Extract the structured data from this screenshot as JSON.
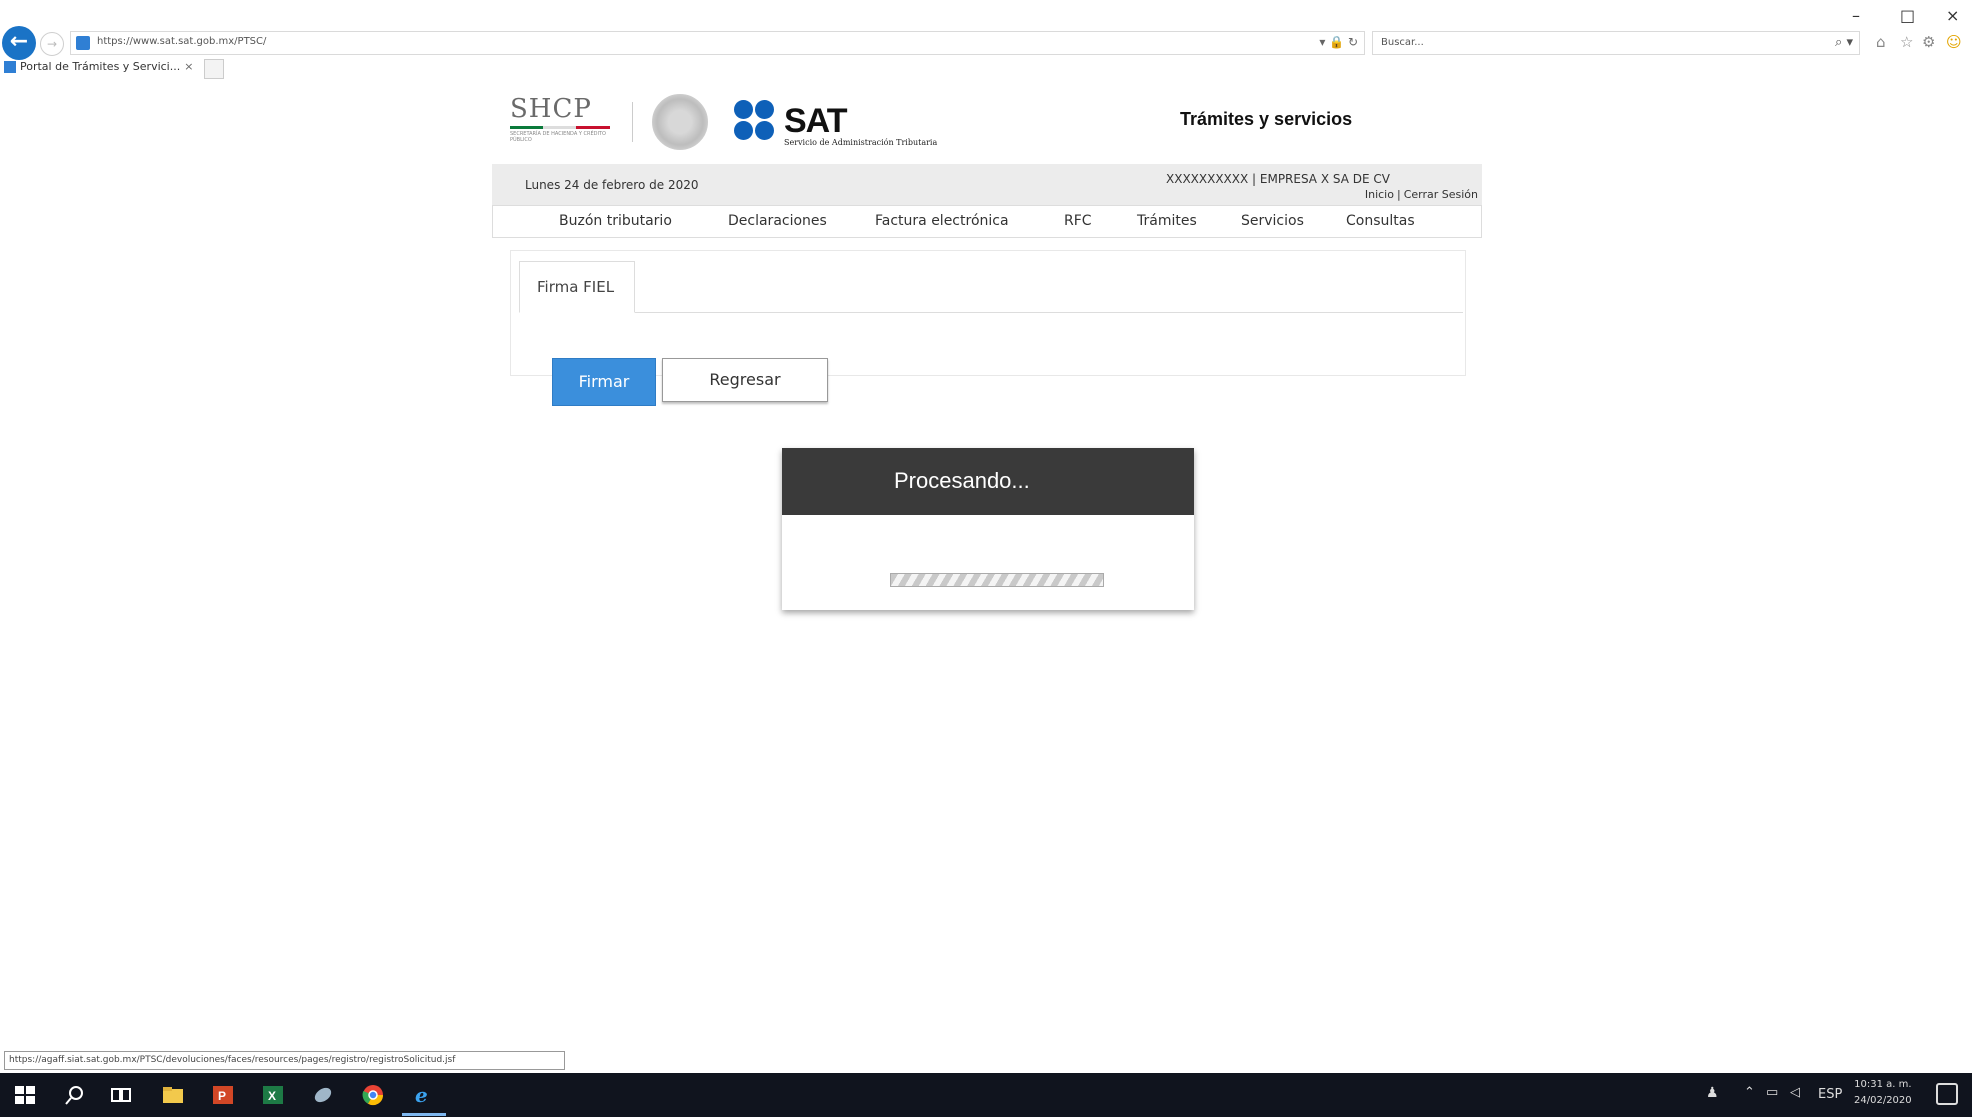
{
  "browser": {
    "url": "https://www.sat.sat.gob.mx/PTSC/",
    "search_placeholder": "Buscar...",
    "tab_title": "Portal de Trámites y Servici...",
    "tab_close": "×",
    "status_url": "https://agaff.siat.sat.gob.mx/PTSC/devoluciones/faces/resources/pages/registro/registroSolicitud.jsf",
    "window_controls": {
      "minimize": "–",
      "maximize": "□",
      "close": "×"
    },
    "address_tools": "▾ 🔒 ↻",
    "search_icon": "⌕ ▾"
  },
  "header": {
    "shcp_text": "SHCP",
    "shcp_sub": "SECRETARÍA DE HACIENDA Y CRÉDITO PÚBLICO",
    "sat_text": "SAT",
    "sat_sub": "Servicio de Administración Tributaria",
    "page_title": "Trámites y servicios"
  },
  "info": {
    "date": "Lunes 24 de febrero de 2020",
    "user": "XXXXXXXXXX   |  EMPRESA X SA DE CV",
    "inicio": "Inicio",
    "separator": "|",
    "cerrar_sesion": "Cerrar Sesión"
  },
  "nav": {
    "items": [
      "Buzón tributario",
      "Declaraciones",
      "Factura electrónica",
      "RFC",
      "Trámites",
      "Servicios",
      "Consultas"
    ]
  },
  "content": {
    "tab_label": "Firma FIEL",
    "firmar_label": "Firmar",
    "regresar_label": "Regresar"
  },
  "modal": {
    "title": "Procesando..."
  },
  "taskbar": {
    "tray_text": "ESP",
    "time": "10:31 a. m.",
    "date": "24/02/2020"
  },
  "colors": {
    "accent_blue": "#3b8fdc",
    "sat_blue": "#0e60b8",
    "modal_header": "#3a3a3a",
    "taskbar": "#10141e"
  }
}
